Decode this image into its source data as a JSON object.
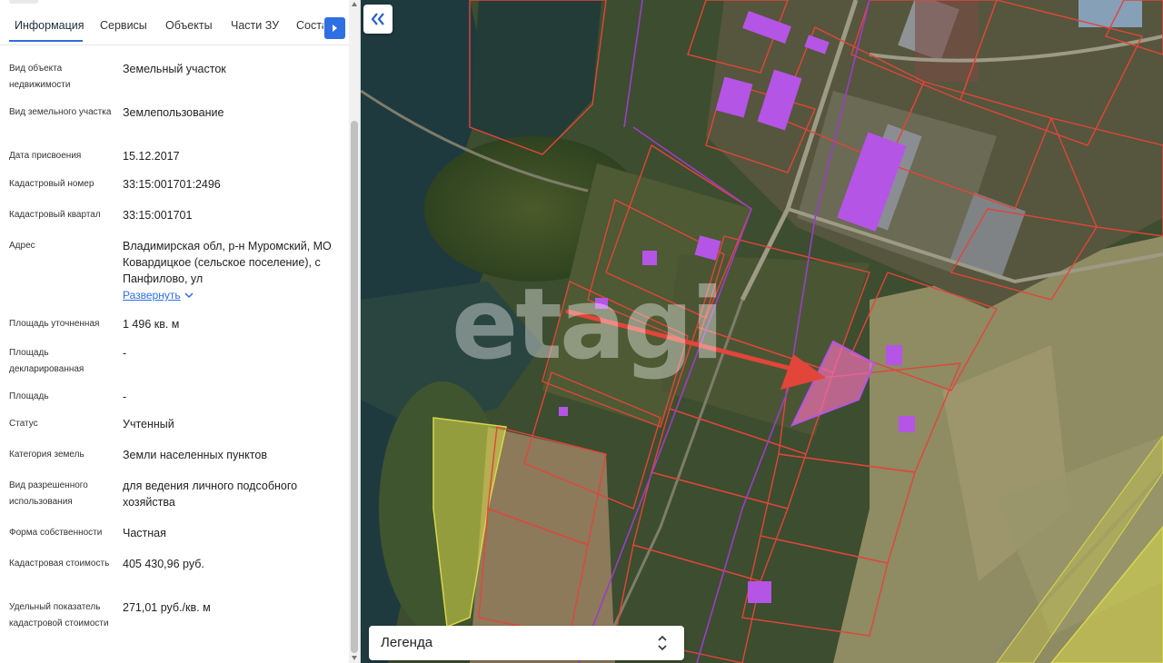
{
  "tabs": [
    {
      "label": "Информация",
      "active": true
    },
    {
      "label": "Сервисы",
      "active": false
    },
    {
      "label": "Объекты",
      "active": false
    },
    {
      "label": "Части ЗУ",
      "active": false
    },
    {
      "label": "Состав",
      "active": false
    }
  ],
  "properties": [
    {
      "label": "Вид объекта недвижимости",
      "value": "Земельный участок"
    },
    {
      "label": "Вид земельного участка",
      "value": "Землепользование"
    },
    {
      "label": "Дата присвоения",
      "value": "15.12.2017"
    },
    {
      "label": "Кадастровый номер",
      "value": "33:15:001701:2496"
    },
    {
      "label": "Кадастровый квартал",
      "value": "33:15:001701"
    },
    {
      "label": "Адрес",
      "value": "Владимирская обл, р-н Муромский, МО Ковардицкое (сельское поселение), с Панфилово, ул"
    },
    {
      "label": "Площадь уточненная",
      "value": "1 496 кв. м"
    },
    {
      "label": "Площадь декларированная",
      "value": "-"
    },
    {
      "label": "Площадь",
      "value": "-"
    },
    {
      "label": "Статус",
      "value": "Учтенный"
    },
    {
      "label": "Категория земель",
      "value": "Земли населенных пунктов"
    },
    {
      "label": "Вид разрешенного использования",
      "value": "для ведения личного подсобного хозяйства"
    },
    {
      "label": "Форма собственности",
      "value": "Частная"
    },
    {
      "label": "Кадастровая стоимость",
      "value": "405 430,96 руб."
    },
    {
      "label": "Удельный показатель кадастровой стоимости",
      "value": "271,01 руб./кв. м"
    }
  ],
  "address_expand_label": "Развернуть",
  "map": {
    "legend_label": "Легенда",
    "watermark": "etagi",
    "colors": {
      "parcel_border": "#e2453a",
      "building": "#b455e6",
      "selected_parcel": "#f06fb4",
      "arrow": "#e2453a",
      "agri_zone": "#d8d84a"
    }
  },
  "icons": {
    "tab_next": "chevron-right-icon",
    "collapse": "double-chevron-left-icon",
    "legend": "updown-chevron-icon",
    "expand": "chevron-down-icon"
  }
}
